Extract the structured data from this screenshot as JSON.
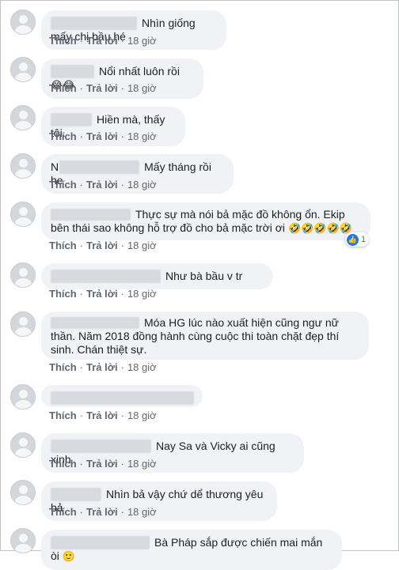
{
  "actions": {
    "like": "Thích",
    "reply": "Trả lời",
    "sep": "·",
    "time": "18 giờ"
  },
  "comments": [
    {
      "text": "Nhìn giống mấy chị bầu hé"
    },
    {
      "text": "Nổi nhất luôn rồi",
      "emoji": "😂😂"
    },
    {
      "text": "Hiền mà, thấy tội."
    },
    {
      "text": "Mấy tháng rồi he",
      "name_initial": "N"
    },
    {
      "text": "Thực sự mà nói bả mặc đồ không ổn. Ekip bên thái sao không hỗ trợ đồ cho bả mặc trời ơi",
      "emoji": "🤣🤣🤣🤣🤣",
      "reaction_count": "1"
    },
    {
      "text": "Như bà bầu v tr"
    },
    {
      "text": "Móa HG lúc nào xuất hiện cũng ngư nữ thần. Năm 2018 đồng hành cùng cuộc thi toàn chặt đẹp thí sinh. Chán thiệt sự."
    },
    {
      "text": ""
    },
    {
      "text": "Nay Sa và Vicky ai cũng xinh"
    },
    {
      "text": "Nhìn bả vậy chứ dể thương yêu bả"
    },
    {
      "text": "Bà Pháp sắp được chiến mai mắn òi",
      "emoji": "🙂"
    }
  ]
}
